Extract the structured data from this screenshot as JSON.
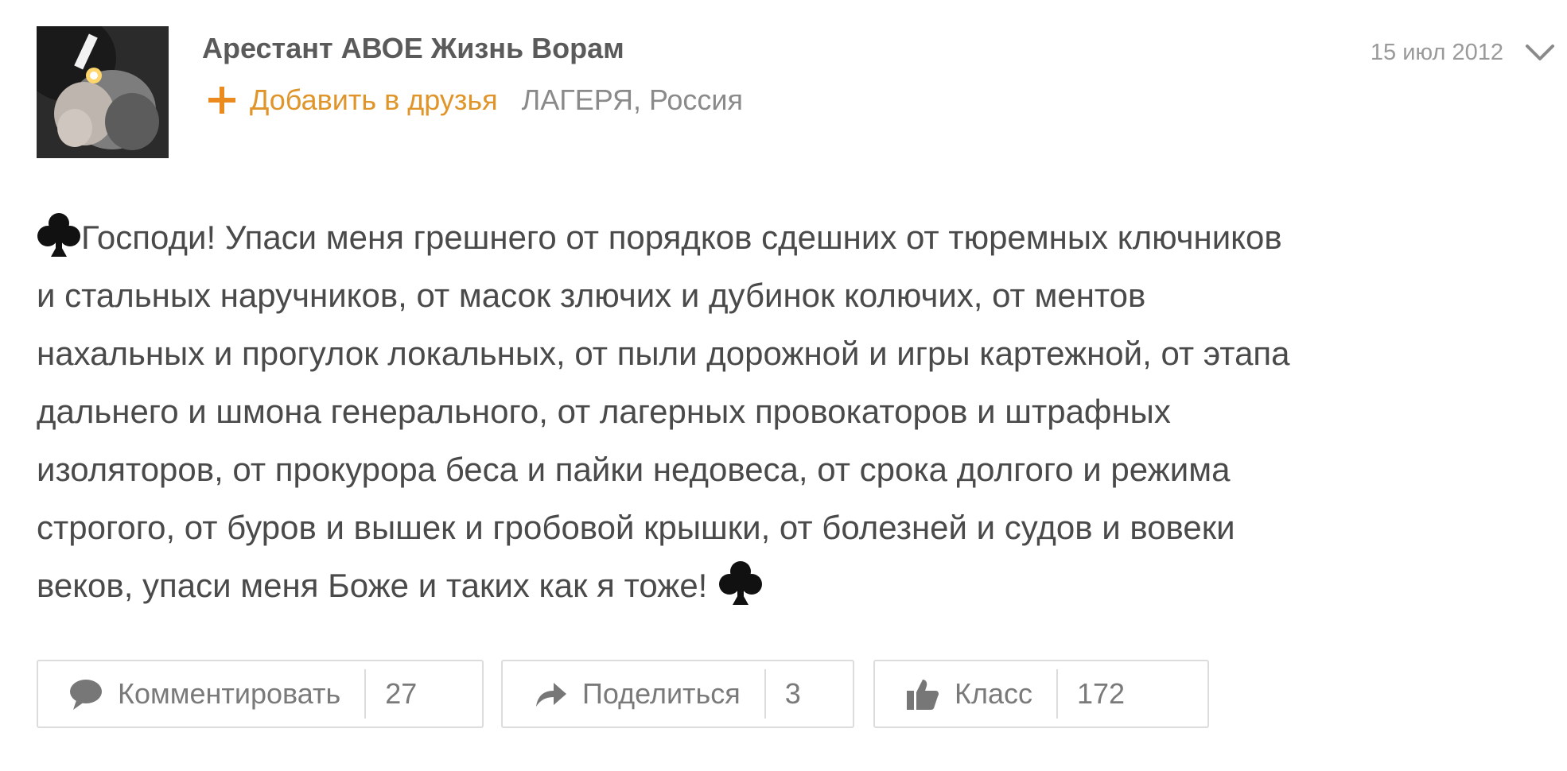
{
  "author": {
    "name": "Арестант АВОЕ Жизнь Ворам",
    "add_friend_label": "Добавить в друзья",
    "location": "ЛАГЕРЯ, Россия"
  },
  "post": {
    "date": "15 июл 2012",
    "lines": [
      "Господи!  Упаси меня грешнего  от порядков сдешних  от тюремных ключников",
      "и стальных наручников,  от масок злючих  и дубинок колючих,  от ментов",
      "нахальных  и прогулок локальных,  от пыли дорожной  и игры картежной,  от этапа",
      "дальнего  и шмона генерального,  от лагерных провокаторов  и штрафных",
      "изоляторов,  от прокурора беса  и пайки недовеса,  от срока долгого  и режима",
      "строгого,  от буров и вышек  и гробовой крышки,  от болезней и судов  и вовеки",
      "веков,  упаси меня Боже  и таких как я тоже!"
    ]
  },
  "actions": {
    "comment": {
      "label": "Комментировать",
      "count": "27"
    },
    "share": {
      "label": "Поделиться",
      "count": "3"
    },
    "like": {
      "label": "Класс",
      "count": "172"
    }
  },
  "icons": {
    "add_friend": "plus-icon",
    "menu": "chevron-down-icon",
    "emoji": "club-suit-icon",
    "comment": "speech-bubble-icon",
    "share": "share-arrow-icon",
    "like": "thumbs-up-icon"
  },
  "colors": {
    "accent": "#eb8a1e",
    "text": "#4a4a4a",
    "muted": "#8a8a8a",
    "border": "#dcdcdc"
  }
}
